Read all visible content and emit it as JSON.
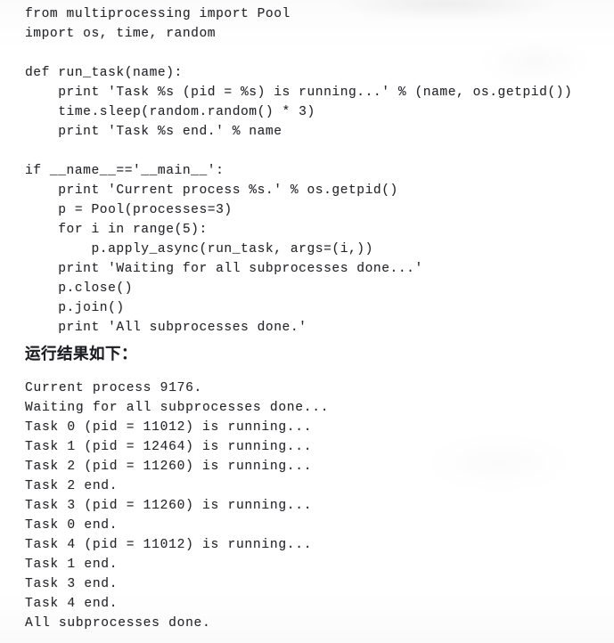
{
  "document": {
    "type": "scanned-book-page",
    "language": "python",
    "page_background": "#fdfdfd",
    "text_color": "#26272b"
  },
  "code_block": {
    "name": "python-multiprocessing-pool-example",
    "lines": [
      "from multiprocessing import Pool",
      "import os, time, random",
      "",
      "def run_task(name):",
      "    print 'Task %s (pid = %s) is running...' % (name, os.getpid())",
      "    time.sleep(random.random() * 3)",
      "    print 'Task %s end.' % name",
      "",
      "if __name__=='__main__':",
      "    print 'Current process %s.' % os.getpid()",
      "    p = Pool(processes=3)",
      "    for i in range(5):",
      "        p.apply_async(run_task, args=(i,))",
      "    print 'Waiting for all subprocesses done...'",
      "    p.close()",
      "    p.join()",
      "    print 'All subprocesses done.'"
    ]
  },
  "result_heading": {
    "text": "运行结果如下："
  },
  "output_block": {
    "name": "program-console-output",
    "lines": [
      "Current process 9176.",
      "Waiting for all subprocesses done...",
      "Task 0 (pid = 11012) is running...",
      "Task 1 (pid = 12464) is running...",
      "Task 2 (pid = 11260) is running...",
      "Task 2 end.",
      "Task 3 (pid = 11260) is running...",
      "Task 0 end.",
      "Task 4 (pid = 11012) is running...",
      "Task 1 end.",
      "Task 3 end.",
      "Task 4 end.",
      "All subprocesses done."
    ]
  }
}
